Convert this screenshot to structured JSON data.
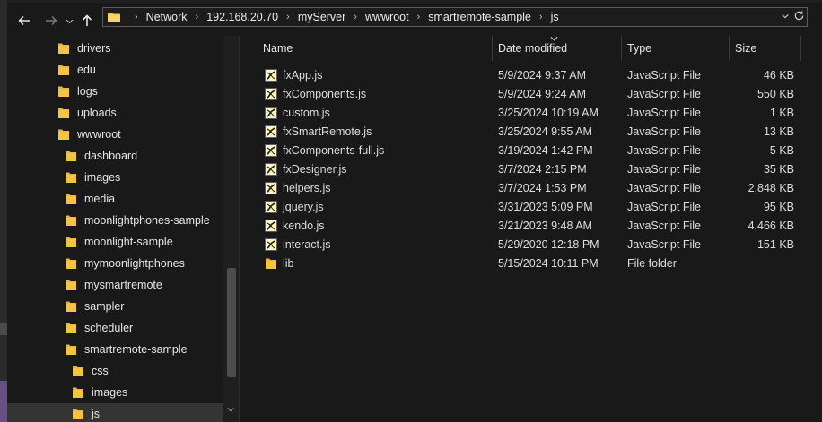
{
  "navigation": {
    "back_icon": "arrow-left-icon",
    "forward_icon": "arrow-right-icon",
    "dropdown_icon": "chevron-down-icon",
    "up_icon": "arrow-up-icon"
  },
  "address_bar": {
    "breadcrumbs": [
      "Network",
      "192.168.20.70",
      "myServer",
      "wwwroot",
      "smartremote-sample",
      "js"
    ]
  },
  "nav_tree": {
    "items": [
      {
        "label": "drivers",
        "level": 0
      },
      {
        "label": "edu",
        "level": 0
      },
      {
        "label": "logs",
        "level": 0
      },
      {
        "label": "uploads",
        "level": 0
      },
      {
        "label": "wwwroot",
        "level": 0
      },
      {
        "label": "dashboard",
        "level": 1
      },
      {
        "label": "images",
        "level": 1
      },
      {
        "label": "media",
        "level": 1
      },
      {
        "label": "moonlightphones-sample",
        "level": 1
      },
      {
        "label": "moonlight-sample",
        "level": 1
      },
      {
        "label": "mymoonlightphones",
        "level": 1
      },
      {
        "label": "mysmartremote",
        "level": 1
      },
      {
        "label": "sampler",
        "level": 1
      },
      {
        "label": "scheduler",
        "level": 1
      },
      {
        "label": "smartremote-sample",
        "level": 1
      },
      {
        "label": "css",
        "level": 2
      },
      {
        "label": "images",
        "level": 2
      },
      {
        "label": "js",
        "level": 2,
        "selected": true
      }
    ]
  },
  "columns": {
    "name": "Name",
    "date_modified": "Date modified",
    "type": "Type",
    "size": "Size"
  },
  "files": [
    {
      "name": "fxApp.js",
      "date": "5/9/2024 9:37 AM",
      "type": "JavaScript File",
      "size": "46 KB",
      "kind": "js"
    },
    {
      "name": "fxComponents.js",
      "date": "5/9/2024 9:24 AM",
      "type": "JavaScript File",
      "size": "550 KB",
      "kind": "js"
    },
    {
      "name": "custom.js",
      "date": "3/25/2024 10:19 AM",
      "type": "JavaScript File",
      "size": "1 KB",
      "kind": "js"
    },
    {
      "name": "fxSmartRemote.js",
      "date": "3/25/2024 9:55 AM",
      "type": "JavaScript File",
      "size": "13 KB",
      "kind": "js"
    },
    {
      "name": "fxComponents-full.js",
      "date": "3/19/2024 1:42 PM",
      "type": "JavaScript File",
      "size": "5 KB",
      "kind": "js"
    },
    {
      "name": "fxDesigner.js",
      "date": "3/7/2024 2:15 PM",
      "type": "JavaScript File",
      "size": "35 KB",
      "kind": "js"
    },
    {
      "name": "helpers.js",
      "date": "3/7/2024 1:53 PM",
      "type": "JavaScript File",
      "size": "2,848 KB",
      "kind": "js"
    },
    {
      "name": "jquery.js",
      "date": "3/31/2023 5:09 PM",
      "type": "JavaScript File",
      "size": "95 KB",
      "kind": "js"
    },
    {
      "name": "kendo.js",
      "date": "3/21/2023 9:48 AM",
      "type": "JavaScript File",
      "size": "4,466 KB",
      "kind": "js"
    },
    {
      "name": "interact.js",
      "date": "5/29/2020 12:18 PM",
      "type": "JavaScript File",
      "size": "151 KB",
      "kind": "js"
    },
    {
      "name": "lib",
      "date": "5/15/2024 10:11 PM",
      "type": "File folder",
      "size": "",
      "kind": "folder"
    }
  ],
  "colors": {
    "background": "#191919",
    "folder_yellow": "#f3c443",
    "selected": "#343434"
  }
}
